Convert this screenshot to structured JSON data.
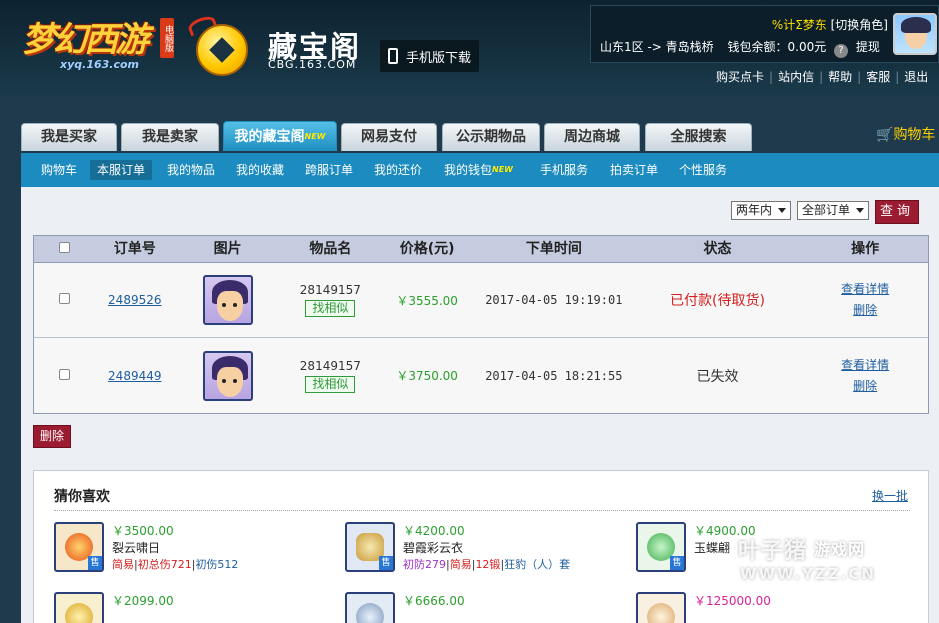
{
  "header": {
    "logo_text": "梦幻西游",
    "logo_badge": "电脑版",
    "logo_domain": "xyq.163.com",
    "cbg_title": "藏宝阁",
    "cbg_domain": "CBG.163.COM",
    "mobile_download": "手机版下载"
  },
  "user": {
    "name": "%计Σ梦东",
    "switch_role": "[切换角色]",
    "server": "山东1区 -> 青岛栈桥",
    "wallet_label": "钱包余额：",
    "wallet_amount": "0.00元",
    "withdraw": "提现"
  },
  "top_links": [
    "购买点卡",
    "站内信",
    "帮助",
    "客服",
    "退出"
  ],
  "main_tabs": [
    {
      "label": "我是买家",
      "active": false
    },
    {
      "label": "我是卖家",
      "active": false
    },
    {
      "label": "我的藏宝阁",
      "active": true,
      "new": "NEW"
    },
    {
      "label": "网易支付",
      "active": false
    },
    {
      "label": "公示期物品",
      "active": false
    },
    {
      "label": "周边商城",
      "active": false
    },
    {
      "label": "全服搜索",
      "active": false
    }
  ],
  "cart_label": "购物车",
  "sub_nav": [
    {
      "label": "购物车"
    },
    {
      "label": "本服订单",
      "active": true
    },
    {
      "label": "我的物品"
    },
    {
      "label": "我的收藏"
    },
    {
      "label": "跨服订单"
    },
    {
      "label": "我的还价"
    },
    {
      "label": "我的钱包",
      "new": "NEW"
    },
    {
      "label": "手机服务"
    },
    {
      "label": "拍卖订单"
    },
    {
      "label": "个性服务"
    }
  ],
  "filters": {
    "time_range": "两年内",
    "order_type": "全部订单",
    "query_button": "查询"
  },
  "table": {
    "headers": [
      "订单号",
      "图片",
      "物品名",
      "价格(元)",
      "下单时间",
      "状态",
      "操作"
    ],
    "rows": [
      {
        "order_id": "2489526",
        "item_name": "28149157",
        "similar": "找相似",
        "price": "￥3555.00",
        "time": "2017-04-05 19:19:01",
        "status": "已付款(待取货)",
        "ops": [
          "查看详情",
          "删除"
        ]
      },
      {
        "order_id": "2489449",
        "item_name": "28149157",
        "similar": "找相似",
        "price": "￥3750.00",
        "time": "2017-04-05 18:21:55",
        "status": "已失效",
        "ops": [
          "查看详情",
          "删除"
        ]
      }
    ]
  },
  "delete_button": "删除",
  "recommend": {
    "title": "猜你喜欢",
    "refresh": "换一批",
    "sell_tag": "售",
    "items": [
      {
        "price": "￥3500.00",
        "name": "裂云啸日",
        "tags": [
          {
            "text": "简易",
            "color": "#d61d1d"
          },
          {
            "text": "|",
            "color": "#333"
          },
          {
            "text": "初总伤721",
            "color": "#d61d1d"
          },
          {
            "text": "|",
            "color": "#333"
          },
          {
            "text": "初伤512",
            "color": "#1e5d9e"
          }
        ],
        "gem_color": "#e8501a"
      },
      {
        "price": "￥4200.00",
        "name": "碧霞彩云衣",
        "tags": [
          {
            "text": "初防279",
            "color": "#a12fc4"
          },
          {
            "text": "|",
            "color": "#333"
          },
          {
            "text": "简易",
            "color": "#d61d1d"
          },
          {
            "text": "|",
            "color": "#333"
          },
          {
            "text": "12锻",
            "color": "#d61d1d"
          },
          {
            "text": "|",
            "color": "#333"
          },
          {
            "text": "狂豹（人）套",
            "color": "#1e5d9e"
          }
        ],
        "gem_color": "#e0c36a"
      },
      {
        "price": "￥4900.00",
        "name": "玉蝶翩",
        "tags": [],
        "gem_color": "#6fcf7a"
      },
      {
        "price": "￥2099.00",
        "name": "",
        "tags": [],
        "gem_color": "#f0d060"
      },
      {
        "price": "￥6666.00",
        "name": "",
        "tags": [],
        "gem_color": "#8aa8c8"
      },
      {
        "price": "￥125000.00",
        "name": "",
        "tags": [],
        "gem_color": "#e8c89a",
        "pink": true
      }
    ]
  },
  "watermark": {
    "text": "叶子猪",
    "sub": "游戏网",
    "url": "WWW.YZZ.CN"
  }
}
